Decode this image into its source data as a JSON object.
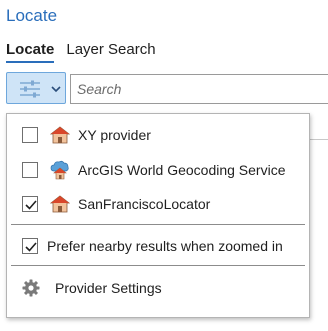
{
  "pane": {
    "title": "Locate"
  },
  "tabs": [
    {
      "label": "Locate",
      "active": true
    },
    {
      "label": "Layer Search",
      "active": false
    }
  ],
  "search": {
    "placeholder": "Search",
    "value": ""
  },
  "providers_menu": {
    "items": [
      {
        "label": "XY provider",
        "checked": false,
        "icon": "house-icon"
      },
      {
        "label": "ArcGIS World Geocoding Service",
        "checked": false,
        "icon": "cloud-house-icon"
      },
      {
        "label": "SanFranciscoLocator",
        "checked": true,
        "icon": "house-icon"
      }
    ],
    "prefer_nearby": {
      "label": "Prefer nearby results when zoomed in",
      "checked": true
    },
    "provider_settings": {
      "label": "Provider Settings",
      "icon": "gear-icon"
    }
  },
  "colors": {
    "accent": "#2a6ebb",
    "toggle_bg": "#cfe4f7",
    "house_roof": "#d9472b"
  }
}
